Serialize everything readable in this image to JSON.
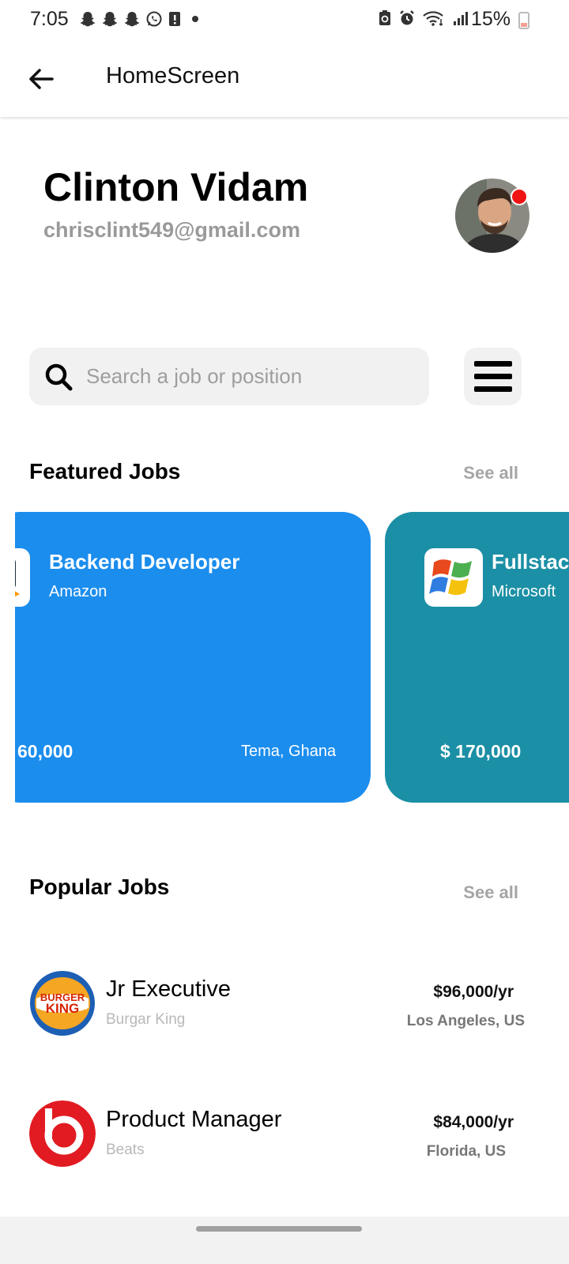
{
  "status_bar": {
    "time": "7:05",
    "battery": "15%",
    "left_icons": [
      "snapchat-icon",
      "snapchat-icon",
      "snapchat-icon",
      "whatsapp-icon",
      "alert-icon",
      "dot-icon"
    ],
    "right_icons": [
      "battery-saver-icon",
      "alarm-icon",
      "wifi-icon",
      "signal-icon"
    ]
  },
  "app_bar": {
    "title": "HomeScreen"
  },
  "profile": {
    "name": "Clinton Vidam",
    "email": "chrisclint549@gmail.com",
    "has_notification": true
  },
  "search": {
    "placeholder": "Search a job or position"
  },
  "featured": {
    "title": "Featured Jobs",
    "see_all": "See all",
    "cards": [
      {
        "title": "Backend Developer",
        "company": "Amazon",
        "salary": "60,000",
        "location": "Tema, Ghana",
        "color": "#1b8ded"
      },
      {
        "title": "Fullstac",
        "company": "Microsoft",
        "salary": "$ 170,000",
        "location": "",
        "color": "#1b8fa5"
      }
    ]
  },
  "popular": {
    "title": "Popular Jobs",
    "see_all": "See all",
    "items": [
      {
        "title": "Jr Executive",
        "company": "Burgar King",
        "salary": "$96,000/yr",
        "location": "Los Angeles, US",
        "logo": "burger-king-logo"
      },
      {
        "title": "Product Manager",
        "company": "Beats",
        "salary": "$84,000/yr",
        "location": "Florida, US",
        "logo": "beats-logo"
      }
    ]
  }
}
